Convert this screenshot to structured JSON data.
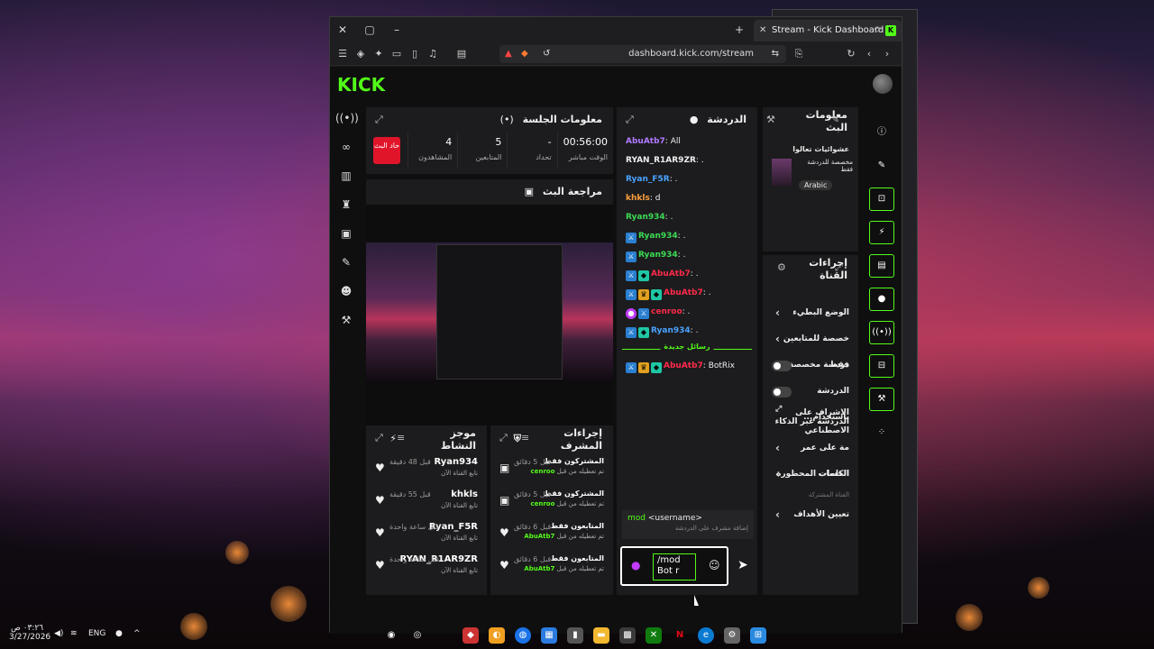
{
  "browser": {
    "tab_title": "Stream - Kick Dashboard",
    "url": "dashboard.kick.com/stream"
  },
  "kick": {
    "logo": "KICK",
    "left_nav": [
      "broadcast-icon",
      "link-icon",
      "chart-icon",
      "trophy-icon",
      "video-icon",
      "wrench-icon",
      "users-icon",
      "mod-icon"
    ],
    "session": {
      "title": "معلومات الجلسة",
      "stats": [
        {
          "value": "00:56:00",
          "label": "الوقت مباشر"
        },
        {
          "value": "-",
          "label": "تحداد"
        },
        {
          "value": "5",
          "label": "المتابعين"
        },
        {
          "value": "4",
          "label": "المشاهدون"
        }
      ],
      "end_button": "حاد البث"
    },
    "preview": {
      "title": "مراجعة البث"
    },
    "chat": {
      "title": "الدردشة",
      "messages": [
        {
          "user": "AbuAtb7",
          "text": ": All",
          "color": "purple",
          "badges": []
        },
        {
          "user": "RYAN_R1AR9ZR",
          "text": ": .",
          "color": "white",
          "badges": []
        },
        {
          "user": "Ryan_F5R",
          "text": ": .",
          "color": "blue",
          "badges": []
        },
        {
          "user": "khkls",
          "text": ": d",
          "color": "orange",
          "badges": []
        },
        {
          "user": "Ryan934",
          "text": ": .",
          "color": "green",
          "badges": []
        },
        {
          "user": "Ryan934",
          "text": ": .",
          "color": "green",
          "badges": [
            "mod"
          ]
        },
        {
          "user": "Ryan934",
          "text": ": .",
          "color": "green",
          "badges": [
            "mod"
          ]
        },
        {
          "user": "AbuAtb7",
          "text": ": .",
          "color": "red",
          "badges": [
            "mod",
            "og"
          ]
        },
        {
          "user": "AbuAtb7",
          "text": ": .",
          "color": "red",
          "badges": [
            "mod",
            "vip",
            "og"
          ]
        },
        {
          "user": "cenroo",
          "text": ": .",
          "color": "red",
          "badges": [
            "mic",
            "mod"
          ]
        },
        {
          "user": "Ryan934",
          "text": ": .",
          "color": "blue",
          "badges": [
            "mod",
            "og"
          ]
        }
      ],
      "new_messages_label": "رسائل جديدة",
      "after_divider": {
        "user": "AbuAtb7",
        "text": ": BotRix",
        "color": "red",
        "badges": [
          "mod",
          "vip",
          "og"
        ]
      },
      "suggestion": {
        "cmd": "mod",
        "arg": "<username>",
        "desc": "إضافة مشرف على الدردشة"
      },
      "input_value": "/mod Bot r"
    },
    "activity": {
      "title": "موجز النشاط",
      "items": [
        {
          "name": "Ryan934",
          "time": "قبل 48 دقيقة",
          "sub": "تابع القناة الآن"
        },
        {
          "name": "khkls",
          "time": "قبل 55 دقيقة",
          "sub": "تابع القناة الآن"
        },
        {
          "name": "Ryan_F5R",
          "time": "قبل ساعة واحدة",
          "sub": "تابع القناة الآن"
        },
        {
          "name": "RYAN_R1AR9ZR",
          "time": "قبل ساعة واحدة",
          "sub": "تابع القناة الآن"
        }
      ]
    },
    "mod_actions": {
      "title": "إجراءات المشرف",
      "items": [
        {
          "name": "المشتركون فقط",
          "time": "قبل 5 دقائق",
          "sub": "تم تعطيله من قبل",
          "by": "cenroo"
        },
        {
          "name": "المشتركون فقط",
          "time": "قبل 5 دقائق",
          "sub": "تم تعطيله من قبل",
          "by": "cenroo"
        },
        {
          "name": "المتابعون فقط",
          "time": "قبل 6 دقائق",
          "sub": "تم تعطيله من قبل",
          "by": "AbuAtb7"
        },
        {
          "name": "المتابعون فقط",
          "time": "قبل 6 دقائق",
          "sub": "تم تعطيله من قبل",
          "by": "AbuAtb7"
        }
      ]
    },
    "stream_info": {
      "title": "معلومات البث",
      "stream_title": "عشوائيات تعالوا",
      "category": "مخصصة للدردشة فقط",
      "language": "Arabic"
    },
    "channel_actions": {
      "title": "إجراءات القناة",
      "rows": [
        {
          "label": "الوضع البطيء",
          "type": "chevron"
        },
        {
          "label": "خصصة للمتابعين فقط",
          "type": "chevron"
        },
        {
          "label": "دردشة مخصصة...",
          "type": "toggle"
        },
        {
          "label": "الدردشة باستخدام...",
          "type": "toggle"
        },
        {
          "label": "الإشراف على الدردشة عبر الذكاء الاصطناعي",
          "type": "link"
        },
        {
          "label": "مة على عمر الحساب",
          "type": "chevron"
        },
        {
          "label": "الكلمات المحظورة",
          "type": "chevron"
        }
      ],
      "section_label": "القناة المشتركة",
      "last_row": "تعيين الأهداف"
    }
  },
  "taskbar": {
    "time": "٠٣:٢٦ ص",
    "date": "3/27/2026",
    "lang": "ENG"
  }
}
